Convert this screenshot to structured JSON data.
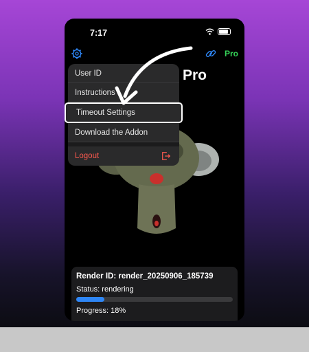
{
  "status_bar": {
    "time": "7:17"
  },
  "header": {
    "title": "Pro",
    "pro_badge": "Pro"
  },
  "menu": {
    "items": [
      {
        "label": "User ID"
      },
      {
        "label": "Instructions"
      },
      {
        "label": "Timeout Settings",
        "highlighted": true
      },
      {
        "label": "Download the Addon"
      }
    ],
    "logout": {
      "label": "Logout"
    }
  },
  "render_card": {
    "render_id": "Render ID: render_20250906_185739",
    "status": "Status: rendering",
    "progress_label": "Progress: 18%",
    "progress_fraction": 0.18
  },
  "colors": {
    "accent": "#2e86f5",
    "pro": "#35d158",
    "logout": "#ff5a4f"
  },
  "icons": [
    "gear-icon",
    "link-icon",
    "logout-icon",
    "wifi-icon",
    "battery-icon",
    "annotation-arrow"
  ]
}
